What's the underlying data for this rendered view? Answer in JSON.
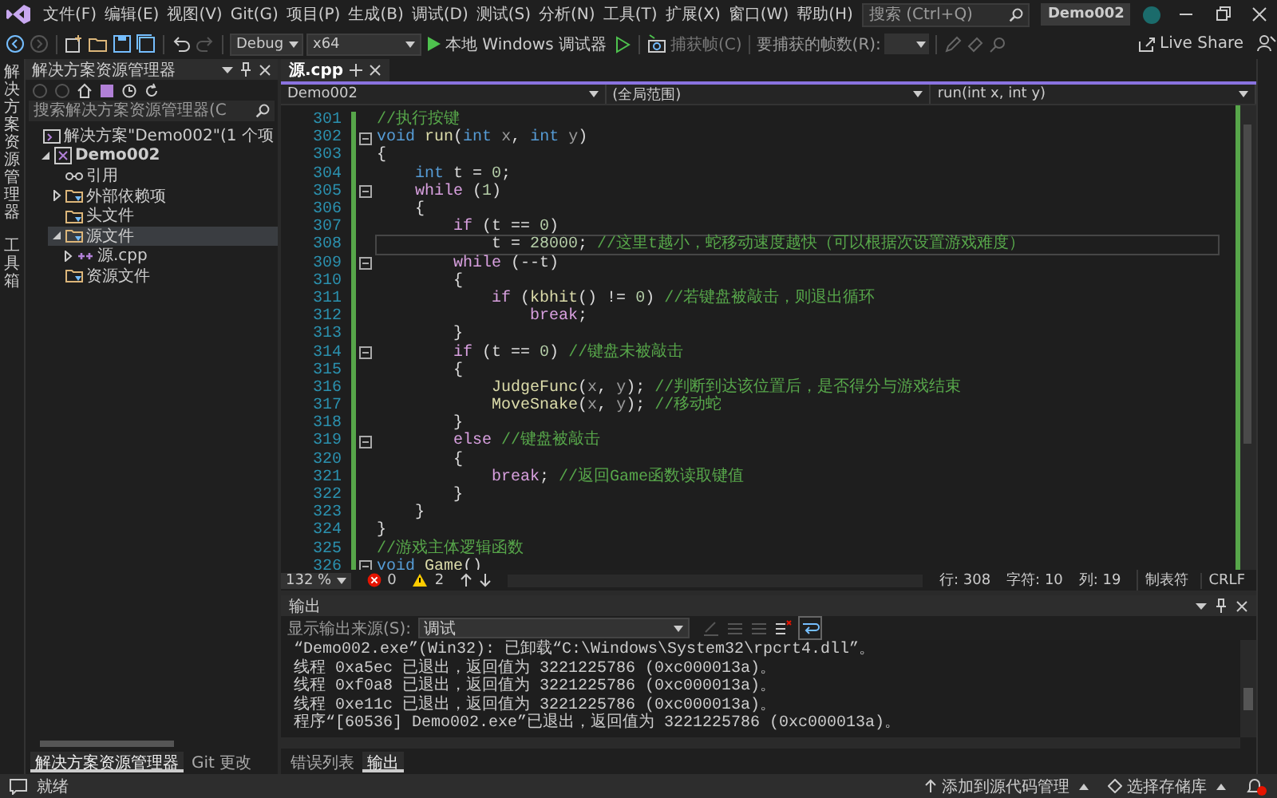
{
  "menu_bar": {
    "items": [
      "文件(F)",
      "编辑(E)",
      "视图(V)",
      "Git(G)",
      "项目(P)",
      "生成(B)",
      "调试(D)",
      "测试(S)",
      "分析(N)",
      "工具(T)",
      "扩展(X)",
      "窗口(W)",
      "帮助(H)"
    ],
    "search": {
      "placeholder": "搜索 (Ctrl+Q)"
    },
    "solution_name": "Demo002"
  },
  "toolbar": {
    "configuration": "Debug",
    "platform": "x64",
    "run_button": "本地 Windows 调试器",
    "capture_frame": {
      "label": "捕获帧(C)",
      "disabled": true
    },
    "frames_label": "要捕获的帧数(R):",
    "live_share": "Live Share"
  },
  "side_tabs": [
    "解决方案资源管理器",
    "工具箱"
  ],
  "solution_explorer": {
    "title": "解决方案资源管理器",
    "search": {
      "placeholder": "搜索解决方案资源管理器(C"
    },
    "tree": [
      {
        "label": "解决方案\"Demo002\"(1 个项",
        "kind": "solution",
        "selected": false,
        "children": [
          {
            "label": "Demo002",
            "kind": "project",
            "expanded": true,
            "selected": false,
            "children": [
              {
                "label": "引用",
                "kind": "references",
                "selected": false
              },
              {
                "label": "外部依赖项",
                "kind": "dependencies",
                "expanded": false,
                "selected": false
              },
              {
                "label": "头文件",
                "kind": "folder",
                "selected": false
              },
              {
                "label": "源文件",
                "kind": "folder",
                "expanded": true,
                "selected": true,
                "children": [
                  {
                    "label": "源.cpp",
                    "kind": "cpp",
                    "expanded": false,
                    "selected": false
                  }
                ]
              },
              {
                "label": "资源文件",
                "kind": "folder",
                "selected": false
              }
            ]
          }
        ]
      }
    ],
    "tabs": [
      {
        "label": "解决方案资源管理器",
        "selected": true
      },
      {
        "label": "Git 更改",
        "selected": false
      }
    ]
  },
  "editor": {
    "tabs": [
      {
        "label": "源.cpp",
        "selected": true
      }
    ],
    "nav": {
      "project": "Demo002",
      "scope": "(全局范围)",
      "member": "run(int x, int y)"
    },
    "lines": [
      {
        "number": "301",
        "fold": false,
        "current": false,
        "tokens": [
          {
            "text": "//执行按键",
            "kind": "comment"
          }
        ]
      },
      {
        "number": "302",
        "fold": true,
        "current": false,
        "tokens": [
          {
            "text": "void",
            "kind": "type"
          },
          {
            "text": " run",
            "kind": "function"
          },
          {
            "text": "(",
            "kind": "plain"
          },
          {
            "text": "int",
            "kind": "type"
          },
          {
            "text": " x",
            "kind": "param"
          },
          {
            "text": ", ",
            "kind": "plain"
          },
          {
            "text": "int",
            "kind": "type"
          },
          {
            "text": " y",
            "kind": "param"
          },
          {
            "text": ")",
            "kind": "plain"
          }
        ]
      },
      {
        "number": "303",
        "fold": false,
        "current": false,
        "tokens": [
          {
            "text": "{",
            "kind": "plain"
          }
        ]
      },
      {
        "number": "304",
        "fold": false,
        "current": false,
        "tokens": [
          {
            "text": "    int",
            "kind": "type"
          },
          {
            "text": " t = ",
            "kind": "plain"
          },
          {
            "text": "0",
            "kind": "number"
          },
          {
            "text": ";",
            "kind": "plain"
          }
        ]
      },
      {
        "number": "305",
        "fold": true,
        "current": false,
        "tokens": [
          {
            "text": "    while",
            "kind": "control"
          },
          {
            "text": " (",
            "kind": "plain"
          },
          {
            "text": "1",
            "kind": "number"
          },
          {
            "text": ")",
            "kind": "plain"
          }
        ]
      },
      {
        "number": "306",
        "fold": false,
        "current": false,
        "tokens": [
          {
            "text": "    {",
            "kind": "plain"
          }
        ]
      },
      {
        "number": "307",
        "fold": false,
        "current": false,
        "tokens": [
          {
            "text": "        if",
            "kind": "control"
          },
          {
            "text": " (t == ",
            "kind": "plain"
          },
          {
            "text": "0",
            "kind": "number"
          },
          {
            "text": ")",
            "kind": "plain"
          }
        ]
      },
      {
        "number": "308",
        "fold": false,
        "current": true,
        "tokens": [
          {
            "text": "            t = ",
            "kind": "plain"
          },
          {
            "text": "28000",
            "kind": "number"
          },
          {
            "text": "; ",
            "kind": "plain"
          },
          {
            "text": "//这里t越小，蛇移动速度越快（可以根据次设置游戏难度）",
            "kind": "comment"
          }
        ]
      },
      {
        "number": "309",
        "fold": true,
        "current": false,
        "tokens": [
          {
            "text": "        while",
            "kind": "control"
          },
          {
            "text": " (--t)",
            "kind": "plain"
          }
        ]
      },
      {
        "number": "310",
        "fold": false,
        "current": false,
        "tokens": [
          {
            "text": "        {",
            "kind": "plain"
          }
        ]
      },
      {
        "number": "311",
        "fold": false,
        "current": false,
        "tokens": [
          {
            "text": "            if",
            "kind": "control"
          },
          {
            "text": " (",
            "kind": "plain"
          },
          {
            "text": "kbhit",
            "kind": "function"
          },
          {
            "text": "() != ",
            "kind": "plain"
          },
          {
            "text": "0",
            "kind": "number"
          },
          {
            "text": ") ",
            "kind": "plain"
          },
          {
            "text": "//若键盘被敲击，则退出循环",
            "kind": "comment"
          }
        ]
      },
      {
        "number": "312",
        "fold": false,
        "current": false,
        "tokens": [
          {
            "text": "                break",
            "kind": "control"
          },
          {
            "text": ";",
            "kind": "plain"
          }
        ]
      },
      {
        "number": "313",
        "fold": false,
        "current": false,
        "tokens": [
          {
            "text": "        }",
            "kind": "plain"
          }
        ]
      },
      {
        "number": "314",
        "fold": true,
        "current": false,
        "tokens": [
          {
            "text": "        if",
            "kind": "control"
          },
          {
            "text": " (t == ",
            "kind": "plain"
          },
          {
            "text": "0",
            "kind": "number"
          },
          {
            "text": ") ",
            "kind": "plain"
          },
          {
            "text": "//键盘未被敲击",
            "kind": "comment"
          }
        ]
      },
      {
        "number": "315",
        "fold": false,
        "current": false,
        "tokens": [
          {
            "text": "        {",
            "kind": "plain"
          }
        ]
      },
      {
        "number": "316",
        "fold": false,
        "current": false,
        "tokens": [
          {
            "text": "            JudgeFunc",
            "kind": "function"
          },
          {
            "text": "(",
            "kind": "plain"
          },
          {
            "text": "x",
            "kind": "param"
          },
          {
            "text": ", ",
            "kind": "plain"
          },
          {
            "text": "y",
            "kind": "param"
          },
          {
            "text": "); ",
            "kind": "plain"
          },
          {
            "text": "//判断到达该位置后，是否得分与游戏结束",
            "kind": "comment"
          }
        ]
      },
      {
        "number": "317",
        "fold": false,
        "current": false,
        "tokens": [
          {
            "text": "            MoveSnake",
            "kind": "function"
          },
          {
            "text": "(",
            "kind": "plain"
          },
          {
            "text": "x",
            "kind": "param"
          },
          {
            "text": ", ",
            "kind": "plain"
          },
          {
            "text": "y",
            "kind": "param"
          },
          {
            "text": "); ",
            "kind": "plain"
          },
          {
            "text": "//移动蛇",
            "kind": "comment"
          }
        ]
      },
      {
        "number": "318",
        "fold": false,
        "current": false,
        "tokens": [
          {
            "text": "        }",
            "kind": "plain"
          }
        ]
      },
      {
        "number": "319",
        "fold": true,
        "current": false,
        "tokens": [
          {
            "text": "        else",
            "kind": "control"
          },
          {
            "text": " //键盘被敲击",
            "kind": "comment"
          }
        ]
      },
      {
        "number": "320",
        "fold": false,
        "current": false,
        "tokens": [
          {
            "text": "        {",
            "kind": "plain"
          }
        ]
      },
      {
        "number": "321",
        "fold": false,
        "current": false,
        "tokens": [
          {
            "text": "            break",
            "kind": "control"
          },
          {
            "text": "; ",
            "kind": "plain"
          },
          {
            "text": "//返回Game函数读取键值",
            "kind": "comment"
          }
        ]
      },
      {
        "number": "322",
        "fold": false,
        "current": false,
        "tokens": [
          {
            "text": "        }",
            "kind": "plain"
          }
        ]
      },
      {
        "number": "323",
        "fold": false,
        "current": false,
        "tokens": [
          {
            "text": "    }",
            "kind": "plain"
          }
        ]
      },
      {
        "number": "324",
        "fold": false,
        "current": false,
        "tokens": [
          {
            "text": "}",
            "kind": "plain"
          }
        ]
      },
      {
        "number": "325",
        "fold": false,
        "current": false,
        "tokens": [
          {
            "text": "//游戏主体逻辑函数",
            "kind": "comment"
          }
        ]
      },
      {
        "number": "326",
        "fold": true,
        "current": false,
        "tokens": [
          {
            "text": "void",
            "kind": "type"
          },
          {
            "text": " Game",
            "kind": "function"
          },
          {
            "text": "()",
            "kind": "plain"
          }
        ]
      }
    ],
    "zoom": "132 %",
    "errors": "0",
    "warnings": "2",
    "position": {
      "line": "行: 308",
      "char": "字符: 10",
      "col": "列: 19"
    },
    "indent": "制表符",
    "eol": "CRLF"
  },
  "output": {
    "title": "输出",
    "source_label": "显示输出来源(S):",
    "source": "调试",
    "lines": [
      "“Demo002.exe”(Win32): 已卸载“C:\\Windows\\System32\\rpcrt4.dll”。",
      "线程 0xa5ec 已退出，返回值为 3221225786 (0xc000013a)。",
      "线程 0xf0a8 已退出，返回值为 3221225786 (0xc000013a)。",
      "线程 0xe11c 已退出，返回值为 3221225786 (0xc000013a)。",
      "程序“[60536] Demo002.exe”已退出，返回值为 3221225786 (0xc000013a)。"
    ],
    "tabs": [
      {
        "label": "错误列表",
        "selected": false
      },
      {
        "label": "输出",
        "selected": true
      }
    ]
  },
  "status_bar": {
    "message": "就绪",
    "source_control": "添加到源代码管理",
    "repository": "选择存储库"
  }
}
